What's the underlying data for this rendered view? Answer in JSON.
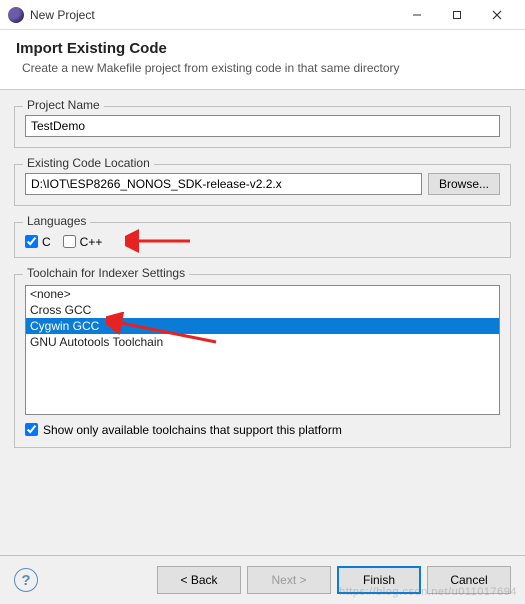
{
  "window": {
    "title": "New Project"
  },
  "banner": {
    "title": "Import Existing Code",
    "description": "Create a new Makefile project from existing code in that same directory"
  },
  "projectName": {
    "label": "Project Name",
    "value": "TestDemo"
  },
  "codeLocation": {
    "label": "Existing Code Location",
    "value": "D:\\IOT\\ESP8266_NONOS_SDK-release-v2.2.x",
    "browseLabel": "Browse..."
  },
  "languages": {
    "label": "Languages",
    "c": {
      "label": "C",
      "checked": true
    },
    "cpp": {
      "label": "C++",
      "checked": false
    }
  },
  "toolchain": {
    "label": "Toolchain for Indexer Settings",
    "items": [
      "<none>",
      "Cross GCC",
      "Cygwin GCC",
      "GNU Autotools Toolchain"
    ],
    "selectedIndex": 2,
    "showOnlyLabel": "Show only available toolchains that support this platform",
    "showOnlyChecked": true
  },
  "footer": {
    "back": "< Back",
    "next": "Next >",
    "finish": "Finish",
    "cancel": "Cancel"
  },
  "watermark": "https://blog.csdn.net/u011017694"
}
